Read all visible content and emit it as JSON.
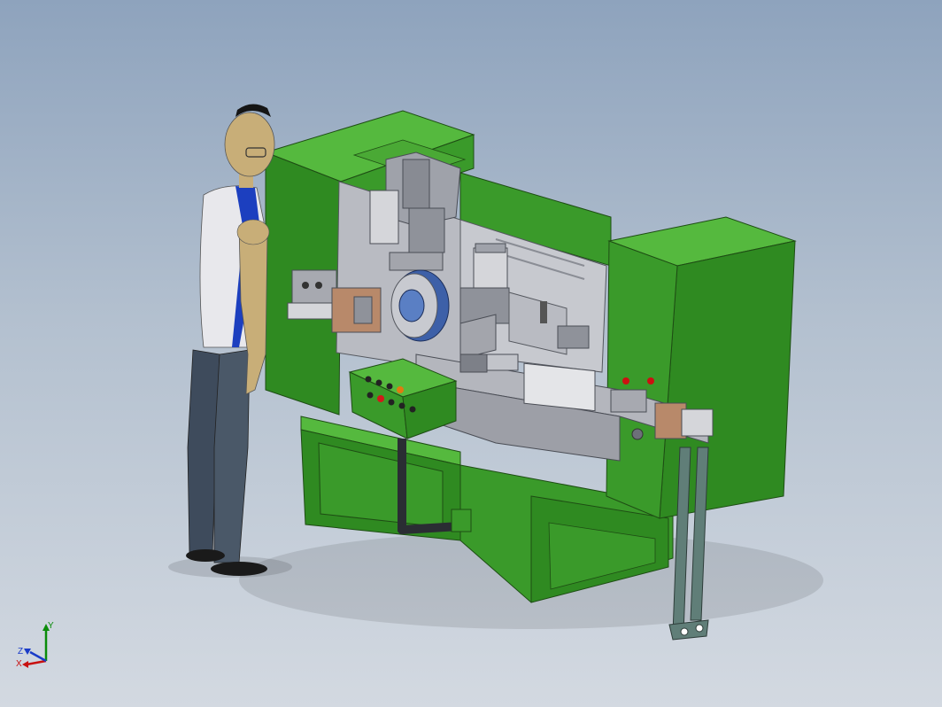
{
  "viewport": {
    "background_top": "#8ea3bd",
    "background_bottom": "#d3d9e1"
  },
  "colors": {
    "machine_green": "#3a9a2a",
    "machine_green_dark": "#256b1b",
    "machine_green_light": "#55b93e",
    "steel": "#a7a9b0",
    "steel_dark": "#6d7079",
    "skin": "#c8ae78",
    "shirt": "#e8e8ec",
    "tie": "#1c3fbf",
    "trousers": "#3e4b5c",
    "button_red": "#d11a1a",
    "button_orange": "#e07a10"
  },
  "triad": {
    "x_label": "X",
    "y_label": "Y",
    "z_label": "Z"
  },
  "objects": {
    "operator": "human-figure",
    "machine": "automatic-assembly-machine",
    "control_panel": "control-box-with-buttons"
  }
}
